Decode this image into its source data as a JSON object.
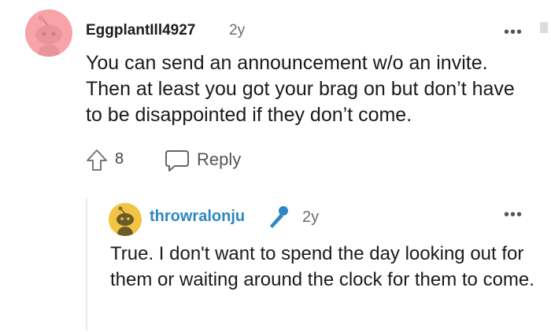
{
  "comment": {
    "username": "EggplantIll4927",
    "age": "2y",
    "body": "You can send an announcement w/o an invite. Then at least you got your brag on but don’t have to be disappointed if they don’t come.",
    "votes": "8",
    "reply_label": "Reply",
    "more_icon": "more-dots-icon",
    "avatar_color": "#f7a3a8"
  },
  "reply": {
    "username": "throwralonju",
    "age": "2y",
    "body": "True. I don't want to spend the day looking out for them or waiting around the clock for them to come.",
    "badge_icon": "microphone-icon",
    "more_icon": "more-dots-icon",
    "username_color": "#2d87c4",
    "avatar_color": "#f3c443"
  }
}
